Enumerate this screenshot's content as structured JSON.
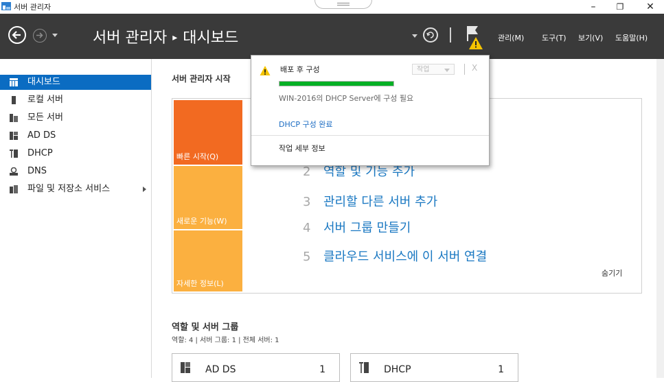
{
  "window": {
    "title": "서버 관리자",
    "controls": {
      "minimize": "–",
      "restore": "❐",
      "close": "✕"
    }
  },
  "header": {
    "breadcrumb_root": "서버 관리자",
    "breadcrumb_sep": "▸",
    "breadcrumb_current": "대시보드",
    "menus": [
      "관리(M)",
      "도구(T)",
      "보기(V)",
      "도움말(H)"
    ]
  },
  "sidebar": {
    "items": [
      {
        "label": "대시보드",
        "icon": "dashboard-icon"
      },
      {
        "label": "로컬 서버",
        "icon": "server-icon"
      },
      {
        "label": "모든 서버",
        "icon": "servers-icon"
      },
      {
        "label": "AD DS",
        "icon": "ad-ds-icon"
      },
      {
        "label": "DHCP",
        "icon": "dhcp-icon"
      },
      {
        "label": "DNS",
        "icon": "dns-icon"
      },
      {
        "label": "파일 및 저장소 서비스",
        "icon": "file-storage-icon"
      }
    ]
  },
  "main": {
    "title": "서버 관리자 시작",
    "tiles": [
      "빠른 시작(Q)",
      "새로운 기능(W)",
      "자세한 정보(L)"
    ],
    "steps": [
      {
        "num": "2",
        "text": "역할 및 기능 추가"
      },
      {
        "num": "3",
        "text": "관리할 다른 서버 추가"
      },
      {
        "num": "4",
        "text": "서버 그룹 만들기"
      },
      {
        "num": "5",
        "text": "클라우드 서비스에 이 서버 연결"
      }
    ],
    "hide": "숨기기",
    "roles_title": "역할 및 서버 그룹",
    "roles_sub": "역할: 4   |   서버 그룹: 1   |   전체 서버: 1",
    "role_cards": [
      {
        "name": "AD DS",
        "count": "1"
      },
      {
        "name": "DHCP",
        "count": "1"
      }
    ]
  },
  "notification": {
    "title": "배포 후 구성",
    "action_label": "작업",
    "close": "X",
    "progress": 1.0,
    "description": "WIN-2016의 DHCP Server에 구성 필요",
    "link": "DHCP 구성 완료",
    "details": "작업 세부 정보"
  },
  "colors": {
    "header_bg": "#3a3a3a",
    "accent_blue": "#0b6cc2",
    "quick_start": "#f26a21",
    "whats_new": "#fbb040",
    "learn_more": "#fbb040",
    "link_blue": "#1a78c2"
  }
}
